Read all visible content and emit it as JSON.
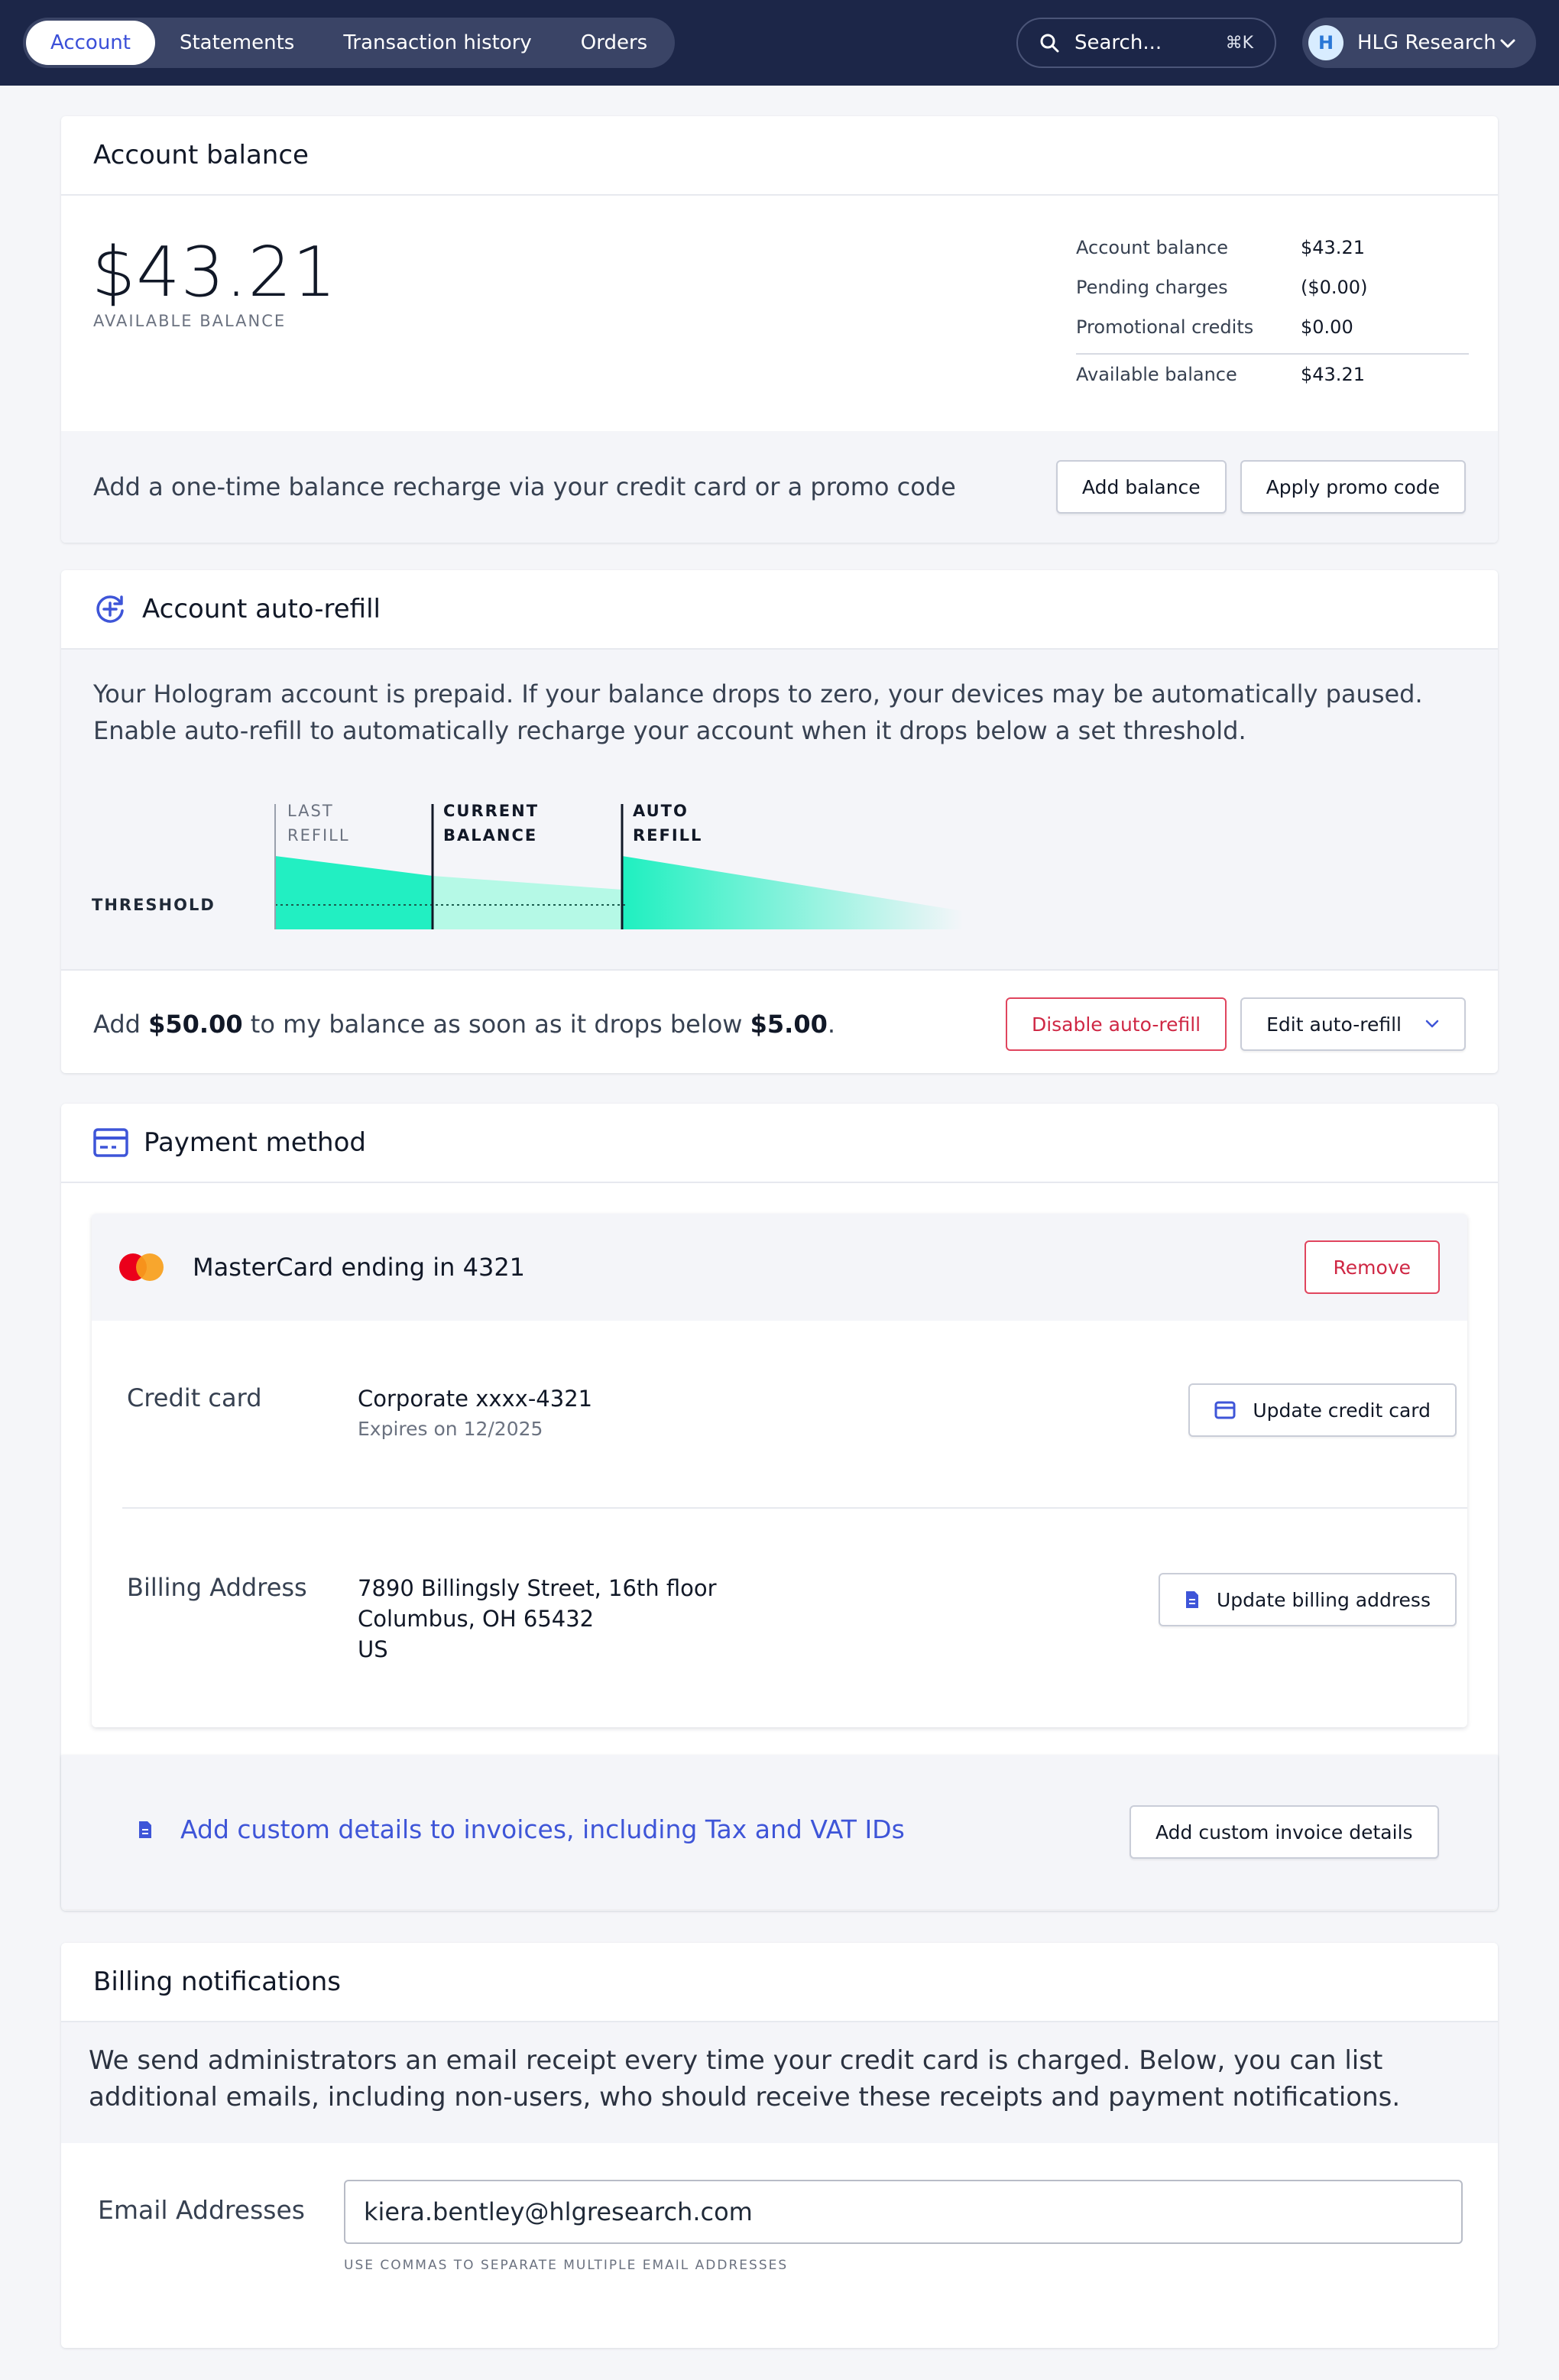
{
  "nav": {
    "tabs": [
      {
        "label": "Account",
        "active": true
      },
      {
        "label": "Statements",
        "active": false
      },
      {
        "label": "Transaction history",
        "active": false
      },
      {
        "label": "Orders",
        "active": false
      }
    ],
    "search_placeholder": "Search...",
    "search_shortcut": "⌘K",
    "account_initial": "H",
    "account_name": "HLG Research"
  },
  "balance": {
    "title": "Account balance",
    "amount": "$43.21",
    "amount_label": "AVAILABLE BALANCE",
    "summary": [
      {
        "label": "Account balance",
        "value": "$43.21"
      },
      {
        "label": "Pending charges",
        "value": "($0.00)"
      },
      {
        "label": "Promotional credits",
        "value": "$0.00"
      }
    ],
    "total": {
      "label": "Available balance",
      "value": "$43.21"
    },
    "recharge_text": "Add a one-time balance recharge via your credit card or a promo code",
    "add_balance_label": "Add balance",
    "apply_promo_label": "Apply promo code"
  },
  "autorefill": {
    "title": "Account auto-refill",
    "description": "Your Hologram account is prepaid. If your balance drops to zero, your devices may be automatically paused. Enable auto-refill to automatically recharge your account when it drops below a set threshold.",
    "diagram": {
      "threshold_label": "THRESHOLD",
      "last_refill_label": [
        "LAST",
        "REFILL"
      ],
      "current_balance_label": [
        "CURRENT",
        "BALANCE"
      ],
      "auto_refill_label": [
        "AUTO",
        "REFILL"
      ]
    },
    "summary_prefix": "Add ",
    "refill_amount": "$50.00",
    "summary_middle": " to my balance as soon as it drops below ",
    "threshold_amount": "$5.00",
    "summary_suffix": ".",
    "disable_label": "Disable auto-refill",
    "edit_label": "Edit auto-refill"
  },
  "payment": {
    "title": "Payment method",
    "card_title": "MasterCard ending in 4321",
    "remove_label": "Remove",
    "credit_card_label": "Credit card",
    "card_name": "Corporate  xxxx-4321",
    "card_expiry": "Expires on 12/2025",
    "update_card_label": "Update credit card",
    "billing_address_label": "Billing Address",
    "address_lines": [
      "7890 Billingsly Street, 16th floor",
      "Columbus, OH 65432",
      "US"
    ],
    "update_address_label": "Update billing address",
    "invoice_link": "Add custom details to invoices, including Tax and VAT IDs",
    "invoice_button": "Add custom invoice details"
  },
  "notifications": {
    "title": "Billing notifications",
    "description": "We send administrators an email receipt every time your credit card is charged. Below, you can list additional emails, including non-users, who should receive these receipts and payment notifications.",
    "email_label": "Email Addresses",
    "email_value": "kiera.bentley@hlgresearch.com",
    "email_help": "USE COMMAS TO SEPARATE MULTIPLE EMAIL ADDRESSES"
  },
  "colors": {
    "nav_bg": "#1c2648",
    "accent": "#3b4fd8",
    "danger": "#cf2744",
    "refill_teal": "#1ef0c0"
  }
}
